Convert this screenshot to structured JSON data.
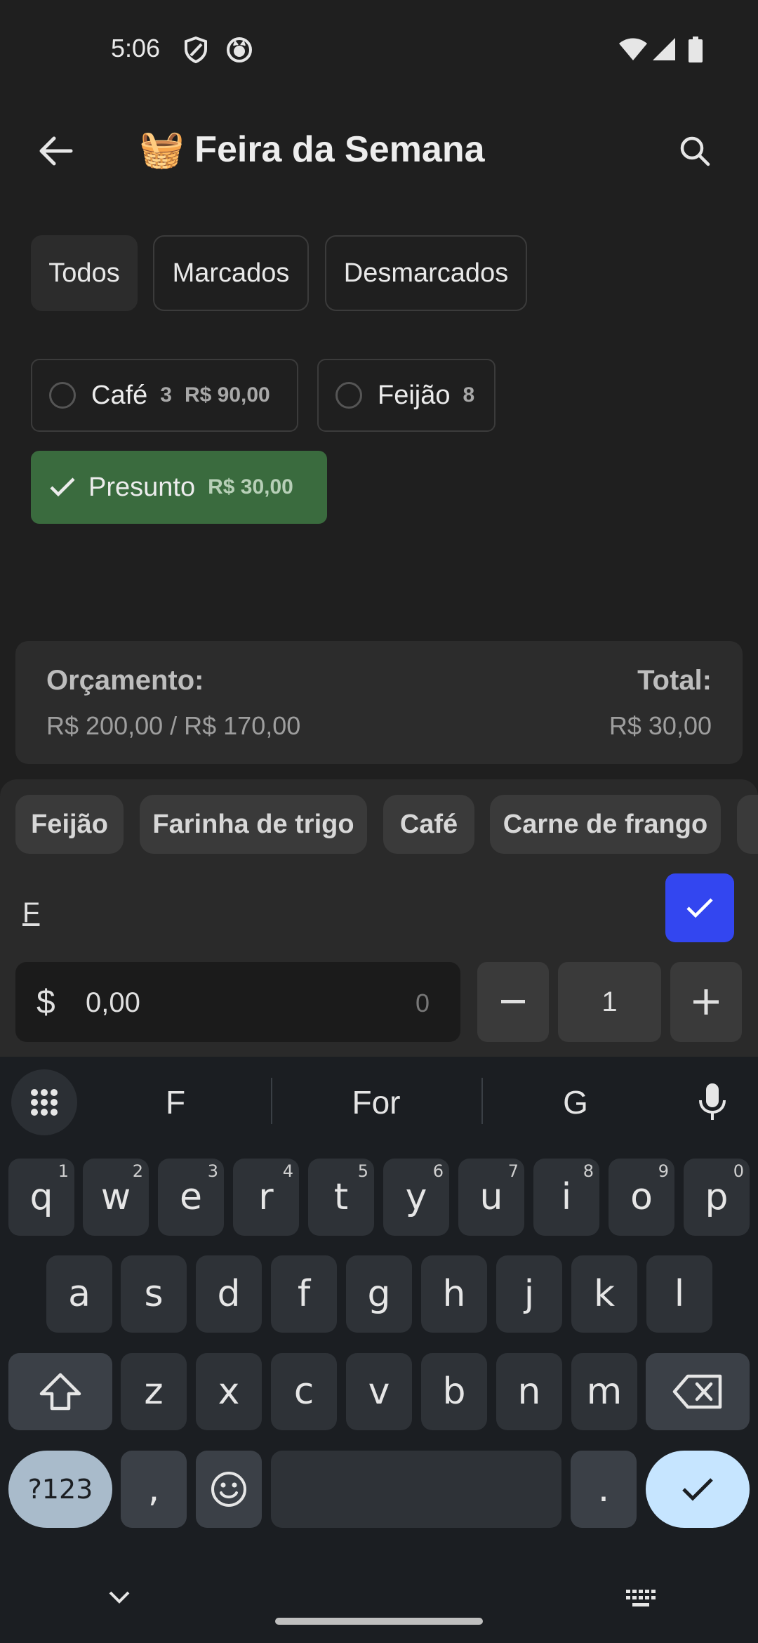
{
  "status_bar": {
    "time": "5:06"
  },
  "app_bar": {
    "title": "🧺 Feira da Semana"
  },
  "filters": [
    "Todos",
    "Marcados",
    "Desmarcados"
  ],
  "items": [
    {
      "name": "Café",
      "qty": "3",
      "price": "R$ 90,00",
      "checked": false
    },
    {
      "name": "Feijão",
      "qty": "8",
      "price": "",
      "checked": false
    },
    {
      "name": "Presunto",
      "qty": "",
      "price": "R$ 30,00",
      "checked": true
    }
  ],
  "budget": {
    "label": "Orçamento:",
    "value": "R$ 200,00 / R$ 170,00",
    "total_label": "Total:",
    "total_value": "R$ 30,00"
  },
  "input_panel": {
    "suggestions": [
      "Feijão",
      "Farinha de trigo",
      "Café",
      "Carne de frango"
    ],
    "name_value": "F",
    "price_symbol": "$",
    "price_value": "0,00",
    "price_char_count": "0",
    "quantity": "1"
  },
  "keyboard": {
    "suggestions": [
      "F",
      "For",
      "G"
    ],
    "row1": [
      {
        "k": "q",
        "h": "1"
      },
      {
        "k": "w",
        "h": "2"
      },
      {
        "k": "e",
        "h": "3"
      },
      {
        "k": "r",
        "h": "4"
      },
      {
        "k": "t",
        "h": "5"
      },
      {
        "k": "y",
        "h": "6"
      },
      {
        "k": "u",
        "h": "7"
      },
      {
        "k": "i",
        "h": "8"
      },
      {
        "k": "o",
        "h": "9"
      },
      {
        "k": "p",
        "h": "0"
      }
    ],
    "row2": [
      "a",
      "s",
      "d",
      "f",
      "g",
      "h",
      "j",
      "k",
      "l"
    ],
    "row3": [
      "z",
      "x",
      "c",
      "v",
      "b",
      "n",
      "m"
    ],
    "symbols_label": "?123",
    "comma": ",",
    "period": "."
  },
  "colors": {
    "background": "#1f1f1f",
    "checked_chip": "#3a6b3e",
    "confirm_button": "#3346f0",
    "enter_key": "#c6e5ff"
  }
}
